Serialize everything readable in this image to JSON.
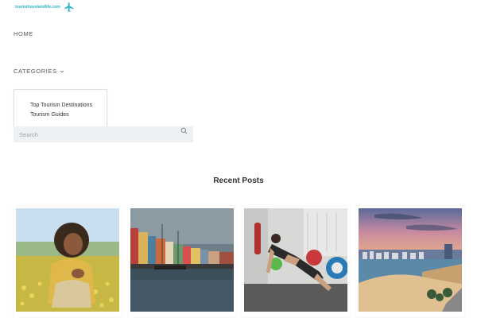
{
  "header": {
    "logo_text": "touristtravelandlife.com",
    "logo_icon": "airplane-icon",
    "accent": "#2fb3c9"
  },
  "nav": {
    "home": "HOME",
    "categories": "CATEGORIES",
    "dropdown": [
      {
        "label": "Top Tourism Destinations"
      },
      {
        "label": "Tourism Guides"
      }
    ]
  },
  "search": {
    "placeholder": "Search",
    "icon": "search-icon"
  },
  "recent": {
    "title": "Recent Posts",
    "posts": [
      {
        "image": "woman-in-flower-field-photo"
      },
      {
        "image": "colorful-harbor-houses-photo"
      },
      {
        "image": "woman-doing-pushups-gym-photo"
      },
      {
        "image": "beach-city-sunset-photo"
      }
    ]
  }
}
